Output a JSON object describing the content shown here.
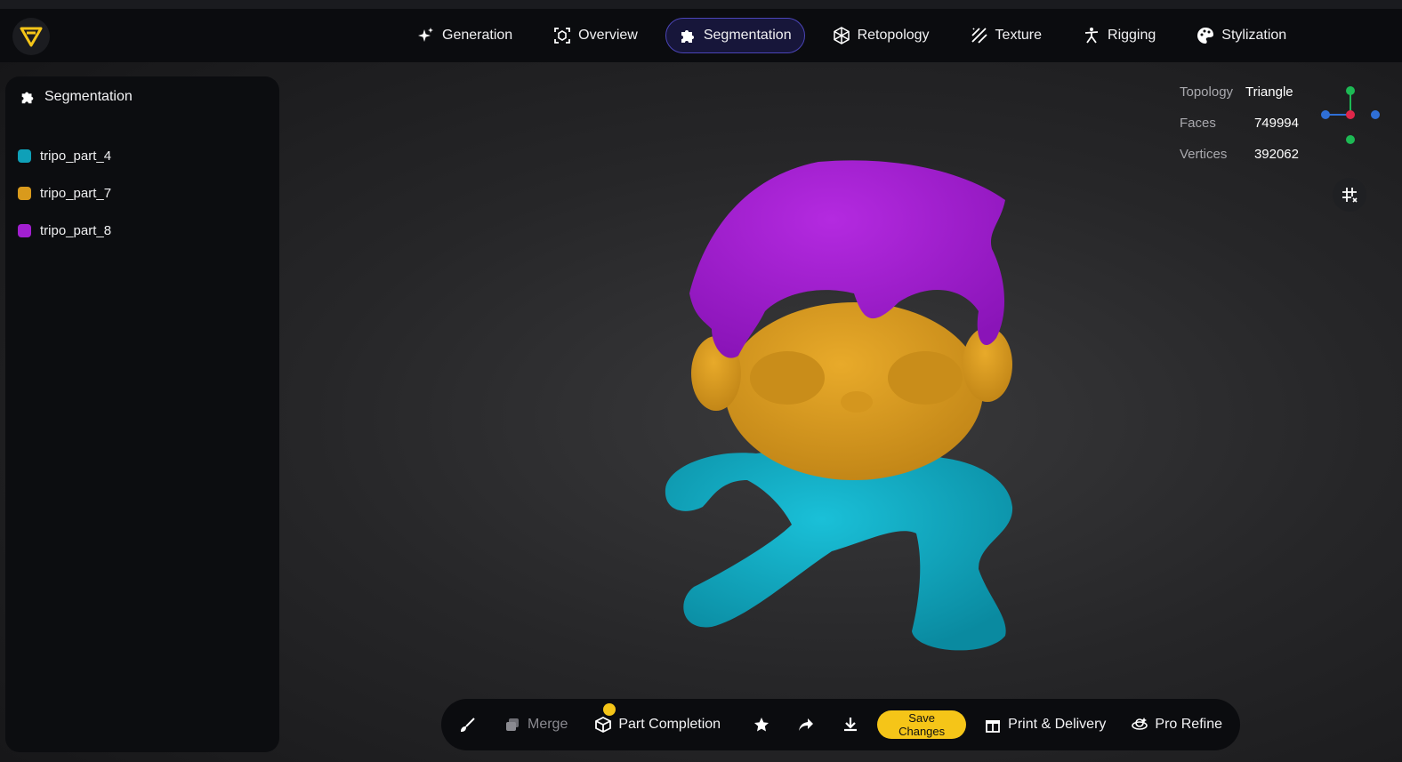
{
  "nav": {
    "items": [
      {
        "label": "Generation",
        "icon": "sparkle-icon",
        "active": false
      },
      {
        "label": "Overview",
        "icon": "scan-cube-icon",
        "active": false
      },
      {
        "label": "Segmentation",
        "icon": "puzzle-icon",
        "active": true
      },
      {
        "label": "Retopology",
        "icon": "mesh-icon",
        "active": false
      },
      {
        "label": "Texture",
        "icon": "hatch-icon",
        "active": false
      },
      {
        "label": "Rigging",
        "icon": "figure-icon",
        "active": false
      },
      {
        "label": "Stylization",
        "icon": "palette-icon",
        "active": false
      }
    ],
    "accent": "#4b45b8"
  },
  "sidebar": {
    "title": "Segmentation",
    "parts": [
      {
        "name": "tripo_part_4",
        "color": "#0fa0b8"
      },
      {
        "name": "tripo_part_7",
        "color": "#d99a1c"
      },
      {
        "name": "tripo_part_8",
        "color": "#a21fd0"
      }
    ]
  },
  "stats": {
    "topology_label": "Topology",
    "topology_value": "Triangle",
    "faces_label": "Faces",
    "faces_value": "749994",
    "vertices_label": "Vertices",
    "vertices_value": "392062"
  },
  "toolbar": {
    "merge_label": "Merge",
    "part_completion_label": "Part Completion",
    "save_label": "Save Changes",
    "print_label": "Print & Delivery",
    "refine_label": "Pro Refine",
    "save_color": "#f5c518"
  }
}
